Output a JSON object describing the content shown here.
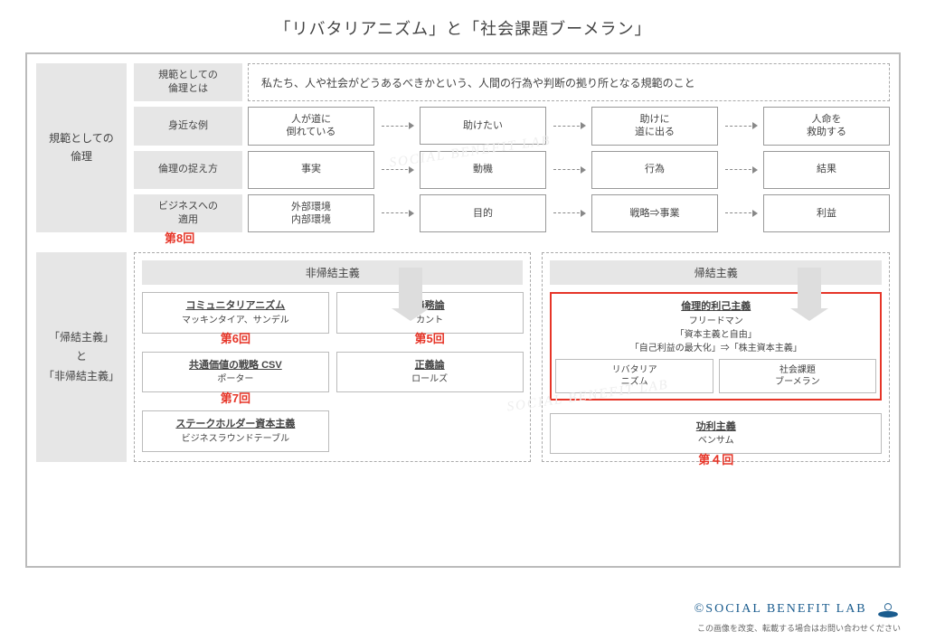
{
  "title": "「リバタリアニズム」と「社会課題ブーメラン」",
  "sec1": {
    "side": "規範としての\n倫理",
    "rows": [
      {
        "label": "規範としての\n倫理とは",
        "desc": "私たち、人や社会がどうあるべきかという、人間の行為や判断の拠り所となる規範のこと"
      },
      {
        "label": "身近な例",
        "boxes": [
          "人が道に\n倒れている",
          "助けたい",
          "助けに\n道に出る",
          "人命を\n救助する"
        ]
      },
      {
        "label": "倫理の捉え方",
        "boxes": [
          "事実",
          "動機",
          "行為",
          "結果"
        ]
      },
      {
        "label": "ビジネスへの\n適用",
        "boxes": [
          "外部環境\n内部環境",
          "目的",
          "戦略⇒事業",
          "利益"
        ],
        "num": "第8回"
      }
    ]
  },
  "sec2": {
    "side": "「帰結主義」\nと\n「非帰結主義」",
    "left": {
      "head": "非帰結主義",
      "col1": [
        {
          "h": "コミュニタリアニズム",
          "sub": "マッキンタイア、サンデル",
          "num": "第6回"
        },
        {
          "h": "共通価値の戦略 CSV",
          "sub": "ポーター",
          "num": "第7回"
        },
        {
          "h": "ステークホルダー資本主義",
          "sub": "ビジネスラウンドテーブル"
        }
      ],
      "col2": [
        {
          "h": "義務論",
          "sub": "カント",
          "num": "第5回"
        },
        {
          "h": "正義論",
          "sub": "ロールズ"
        }
      ]
    },
    "right": {
      "head": "帰結主義",
      "items": [
        {
          "h": "倫理的利己主義",
          "sub": "フリードマン\n「資本主義と自由」\n「自己利益の最大化」⇒「株主資本主義」",
          "mini": [
            "リバタリア\nニズム",
            "社会課題\nブーメラン"
          ],
          "hi": true
        },
        {
          "h": "功利主義",
          "sub": "ベンサム",
          "num": "第４回"
        }
      ]
    }
  },
  "watermark": "SOCIAL BENEFIT LAB",
  "footer": {
    "brand": "©SOCIAL BENEFIT LAB",
    "note": "この画像を改変、転載する場合はお問い合わせください"
  }
}
